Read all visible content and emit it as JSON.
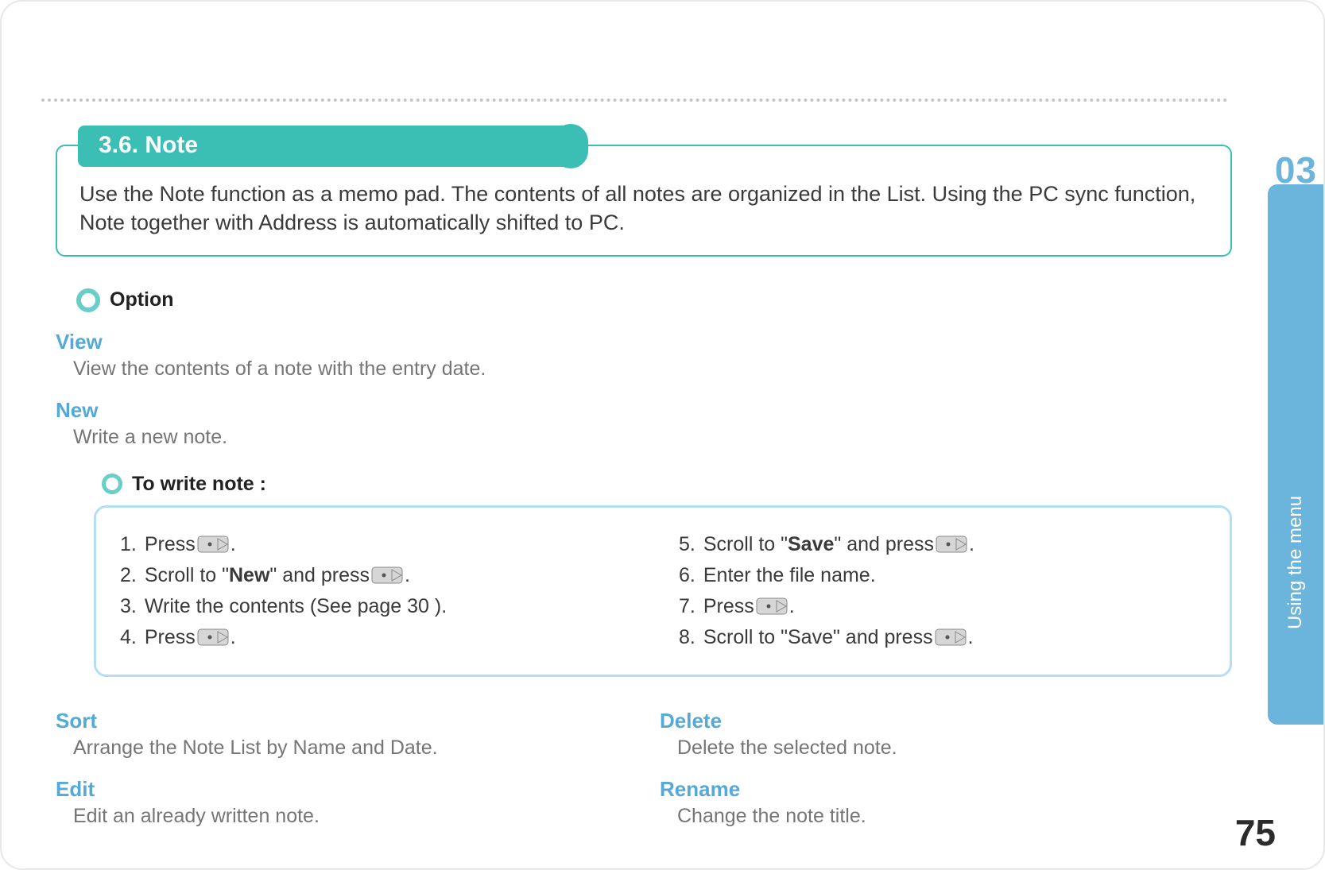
{
  "chapter": {
    "number": "03",
    "label": "Using the menu"
  },
  "page_number": "75",
  "section": {
    "title": "3.6. Note",
    "intro": "Use the Note function as a memo pad. The contents of all notes are organized in the List. Using the PC sync function, Note together with Address is automatically shifted to PC."
  },
  "option_label": "Option",
  "subs": {
    "view": {
      "title": "View",
      "desc": "View the contents of a note with the entry date."
    },
    "new": {
      "title": "New",
      "desc": "Write a new note."
    },
    "sort": {
      "title": "Sort",
      "desc": "Arrange the Note List by Name and Date."
    },
    "edit": {
      "title": "Edit",
      "desc": "Edit an already written note."
    },
    "delete": {
      "title": "Delete",
      "desc": "Delete the selected note."
    },
    "rename": {
      "title": "Rename",
      "desc": "Change the note title."
    }
  },
  "procedure": {
    "title": "To write note :",
    "steps": {
      "s1": {
        "num": "1.",
        "pre": "Press ",
        "post": "."
      },
      "s2": {
        "num": "2.",
        "pre": "Scroll to \"",
        "bold": "New",
        "mid": "\" and press ",
        "post": "."
      },
      "s3": {
        "num": "3.",
        "text": "Write the contents (See page 30 )."
      },
      "s4": {
        "num": "4.",
        "pre": "Press ",
        "post": "."
      },
      "s5": {
        "num": "5.",
        "pre": "Scroll to \"",
        "bold": "Save",
        "mid": "\" and press ",
        "post": "."
      },
      "s6": {
        "num": "6.",
        "text": "Enter the file name."
      },
      "s7": {
        "num": "7.",
        "pre": "Press ",
        "post": "."
      },
      "s8": {
        "num": "8.",
        "pre": "Scroll to \"Save\" and press ",
        "post": "."
      }
    }
  }
}
